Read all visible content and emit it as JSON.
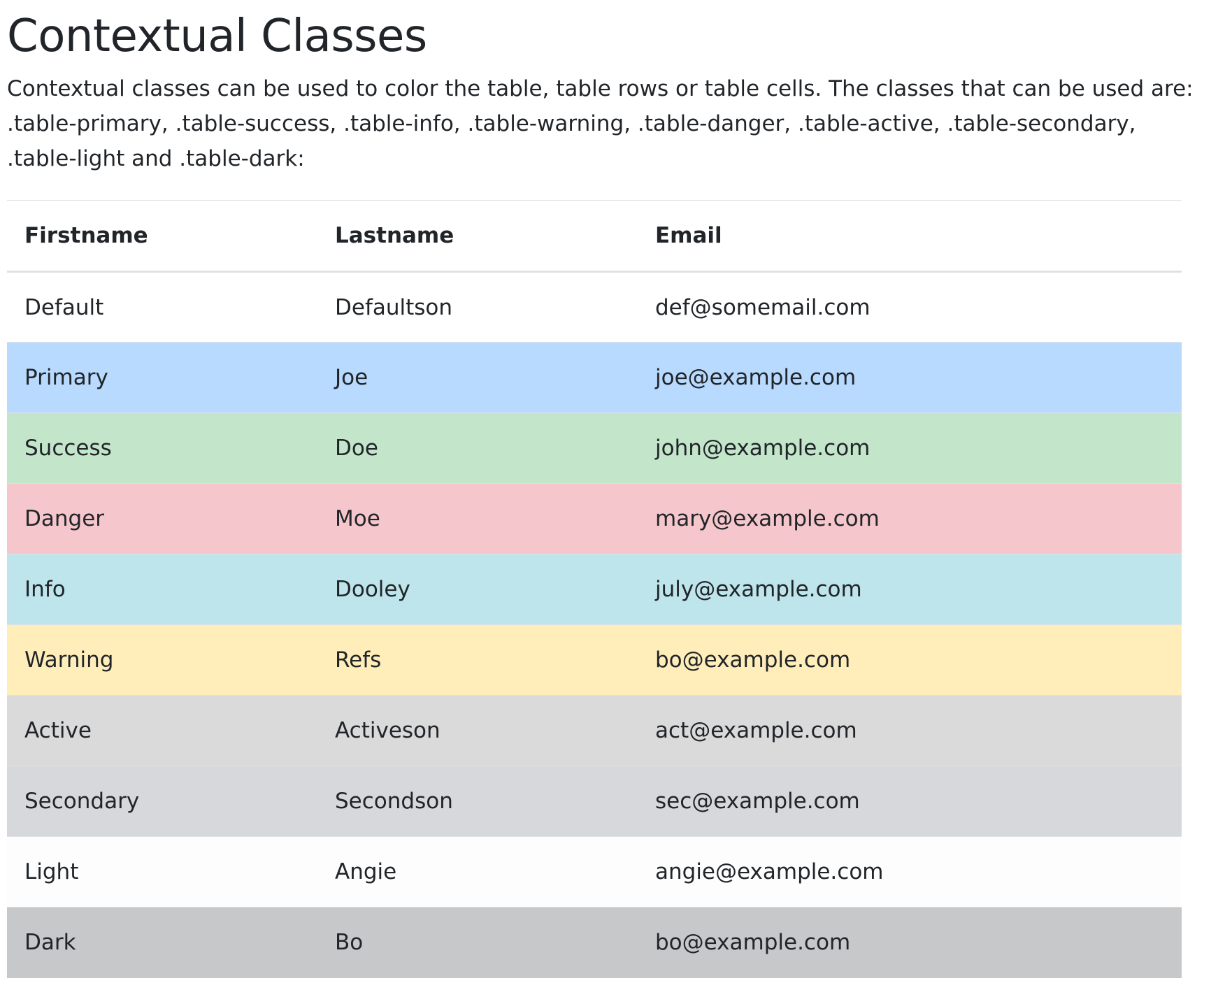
{
  "heading": "Contextual Classes",
  "intro": "Contextual classes can be used to color the table, table rows or table cells. The classes that can be used are: .table-primary, .table-success, .table-info, .table-warning, .table-danger, .table-active, .table-secondary, .table-light and .table-dark:",
  "table": {
    "headers": [
      "Firstname",
      "Lastname",
      "Email"
    ],
    "rows": [
      {
        "first": "Default",
        "last": "Defaultson",
        "email": "def@somemail.com",
        "color": "#ffffff"
      },
      {
        "first": "Primary",
        "last": "Joe",
        "email": "joe@example.com",
        "color": "#b8daff"
      },
      {
        "first": "Success",
        "last": "Doe",
        "email": "john@example.com",
        "color": "#c3e6cb"
      },
      {
        "first": "Danger",
        "last": "Moe",
        "email": "mary@example.com",
        "color": "#f5c6cb"
      },
      {
        "first": "Info",
        "last": "Dooley",
        "email": "july@example.com",
        "color": "#bee5eb"
      },
      {
        "first": "Warning",
        "last": "Refs",
        "email": "bo@example.com",
        "color": "#ffeeba"
      },
      {
        "first": "Active",
        "last": "Activeson",
        "email": "act@example.com",
        "color": "#dadadb"
      },
      {
        "first": "Secondary",
        "last": "Secondson",
        "email": "sec@example.com",
        "color": "#d6d8db"
      },
      {
        "first": "Light",
        "last": "Angie",
        "email": "angie@example.com",
        "color": "#fdfdfe"
      },
      {
        "first": "Dark",
        "last": "Bo",
        "email": "bo@example.com",
        "color": "#c6c8ca"
      }
    ]
  }
}
